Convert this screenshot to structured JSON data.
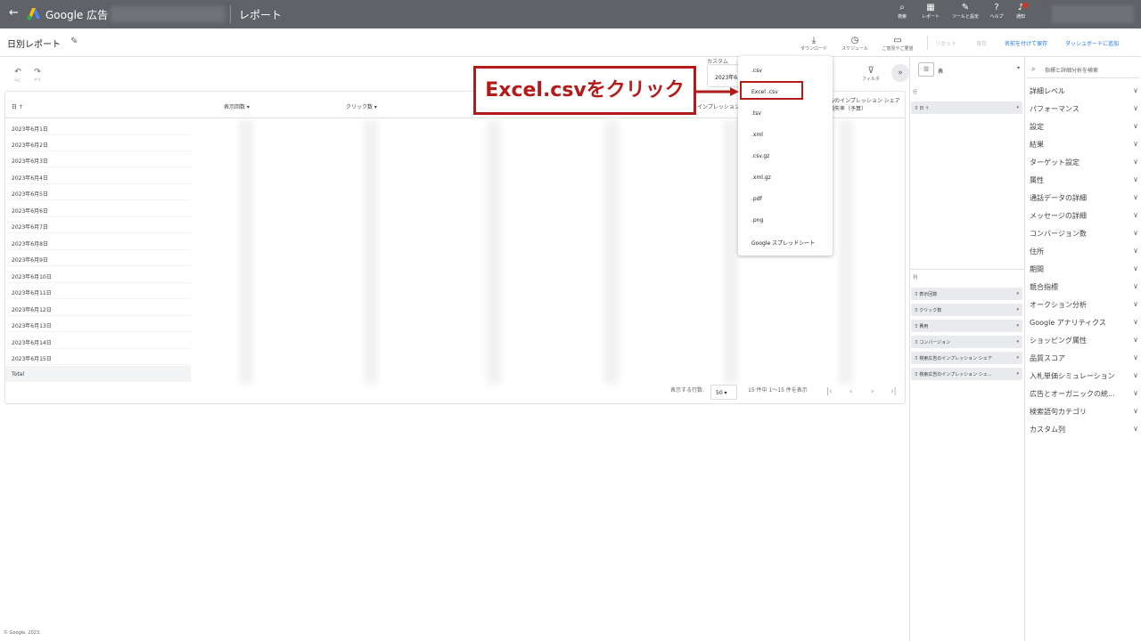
{
  "topbar": {
    "brand": "Google 広告",
    "title": "レポート",
    "icons": [
      {
        "icon": "search-icon",
        "label": "検索"
      },
      {
        "icon": "reports-icon",
        "label": "レポート"
      },
      {
        "icon": "tools-icon",
        "label": "ツールと設定"
      },
      {
        "icon": "help-icon",
        "label": "ヘルプ"
      },
      {
        "icon": "bell-icon",
        "label": "通知"
      }
    ]
  },
  "subbar": {
    "report_name": "日別レポート",
    "download": "ダウンロード",
    "schedule": "スケジュール",
    "feedback": "ご意見やご要望",
    "reset": "リセット",
    "save": "保存",
    "save_as": "名前を付けて保存",
    "add_dashboard": "ダッシュボードに追加"
  },
  "controls": {
    "undo": "元に",
    "redo": "やり",
    "custom_label": "カスタム",
    "date_value": "2023年6...",
    "filter": "フィルタ"
  },
  "table": {
    "columns": [
      "日",
      "表示回数",
      "クリック数",
      "インプレッション",
      "告のインプレッション シェア損失率（予算）"
    ],
    "rows": [
      "2023年6月1日",
      "2023年6月2日",
      "2023年6月3日",
      "2023年6月4日",
      "2023年6月5日",
      "2023年6月6日",
      "2023年6月7日",
      "2023年6月8日",
      "2023年6月9日",
      "2023年6月10日",
      "2023年6月11日",
      "2023年6月12日",
      "2023年6月13日",
      "2023年6月14日",
      "2023年6月15日"
    ],
    "total_label": "Total",
    "rows_label": "表示する行数:",
    "rows_value": "50",
    "range_label": "15 件中 1～15 件を表示"
  },
  "download_menu": {
    "items": [
      ".csv",
      "Excel .csv",
      ".tsv",
      ".xml",
      ".csv.gz",
      ".xml.gz",
      ".pdf",
      ".png",
      "Google スプレッドシート"
    ],
    "highlight_color": "#b31b1b"
  },
  "callout": {
    "text": "Excel.csvをクリック"
  },
  "mid_panel": {
    "viz_label": "表",
    "rows_section": "行",
    "row_chips": [
      "日"
    ],
    "columns_section": "列",
    "column_chips": [
      "表示回数",
      "クリック数",
      "費用",
      "コンバージョン",
      "検索広告のインプレッション シェア",
      "検索広告のインプレッション シェ..."
    ]
  },
  "right_panel": {
    "search_placeholder": "指標と詳細分析を検索",
    "categories": [
      "詳細レベル",
      "パフォーマンス",
      "設定",
      "結果",
      "ターゲット設定",
      "属性",
      "通話データの詳細",
      "メッセージの詳細",
      "コンバージョン数",
      "住所",
      "期間",
      "競合指標",
      "オークション分析",
      "Google アナリティクス",
      "ショッピング属性",
      "品質スコア",
      "入札単価シミュレーション",
      "広告とオーガニックの統...",
      "検索語句カテゴリ",
      "カスタム列"
    ]
  },
  "footer": "© Google, 2023.",
  "colors": {
    "topbar": "#5f6368",
    "accent": "#1a73e8",
    "annotation": "#b31b1b"
  }
}
